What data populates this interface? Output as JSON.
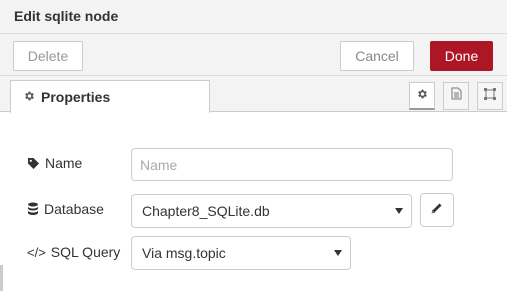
{
  "header": {
    "title": "Edit sqlite node"
  },
  "toolbar": {
    "delete_label": "Delete",
    "cancel_label": "Cancel",
    "done_label": "Done"
  },
  "tabs": {
    "properties_label": "Properties"
  },
  "form": {
    "name": {
      "label": "Name",
      "placeholder": "Name",
      "value": ""
    },
    "database": {
      "label": "Database",
      "value": "Chapter8_SQLite.db"
    },
    "sql_query": {
      "label": "SQL Query",
      "icon_text": "</>",
      "value": "Via msg.topic"
    }
  },
  "colors": {
    "done_button": "#ad1625",
    "header_bg": "#f3f3f3",
    "border": "#cccccc"
  },
  "icons": [
    "gear-icon",
    "tag-icon",
    "database-icon",
    "code-icon",
    "pencil-icon",
    "document-icon",
    "frame-icon",
    "chevron-down-icon"
  ]
}
